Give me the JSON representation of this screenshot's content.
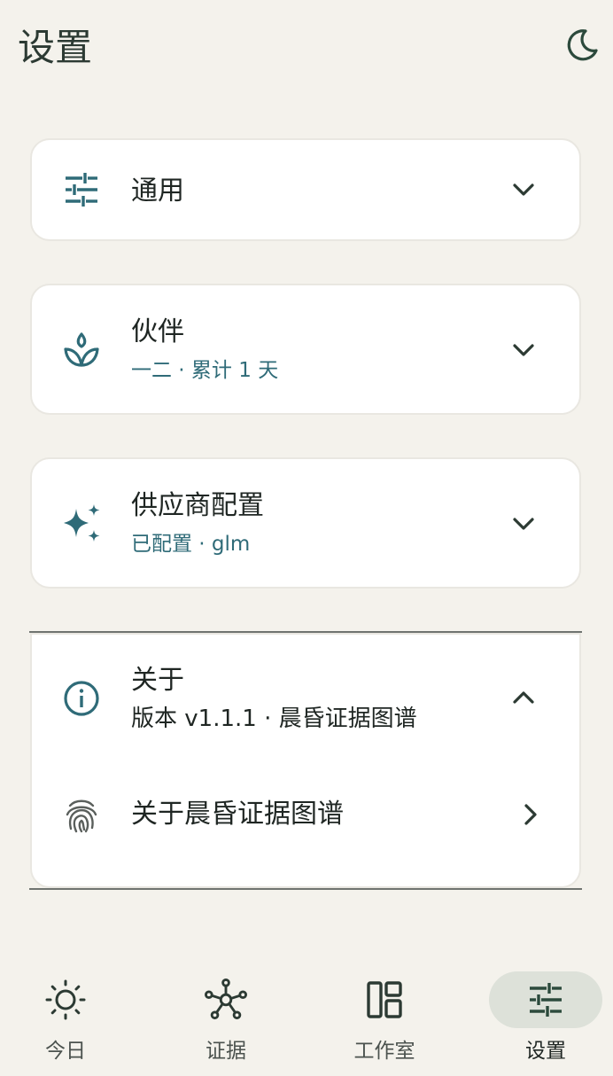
{
  "header": {
    "title": "设置",
    "theme_icon": "moon-icon"
  },
  "sections": [
    {
      "title": "通用",
      "subtitle": "",
      "icon": "tune-sliders-icon",
      "expanded": false
    },
    {
      "title": "伙伴",
      "subtitle": "一二 · 累计 1 天",
      "icon": "sprout-icon",
      "expanded": false
    },
    {
      "title": "供应商配置",
      "subtitle": "已配置 · glm",
      "icon": "sparkles-icon",
      "expanded": false
    },
    {
      "title": "关于",
      "subtitle": "版本 v1.1.1 · 晨昏证据图谱",
      "icon": "info-icon",
      "expanded": true,
      "items": [
        {
          "label": "关于晨昏证据图谱",
          "icon": "fingerprint-icon"
        }
      ]
    }
  ],
  "nav": {
    "items": [
      {
        "label": "今日",
        "icon": "sun-icon",
        "active": false
      },
      {
        "label": "证据",
        "icon": "graph-nodes-icon",
        "active": false
      },
      {
        "label": "工作室",
        "icon": "dashboard-layout-icon",
        "active": false
      },
      {
        "label": "设置",
        "icon": "tune-sliders-icon",
        "active": true
      }
    ]
  },
  "colors": {
    "background": "#f4f2ec",
    "card": "#ffffff",
    "accent": "#2f6b78",
    "nav_active_pill": "#dde1d9"
  }
}
